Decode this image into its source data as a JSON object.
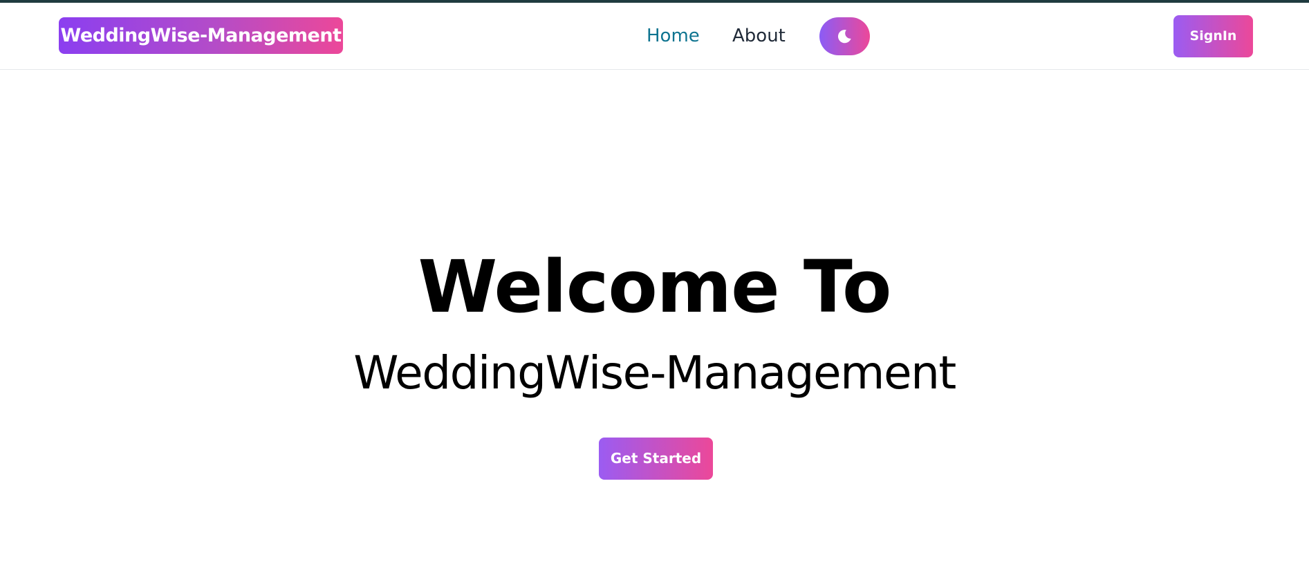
{
  "navbar": {
    "brand": "WeddingWise-Management",
    "links": [
      {
        "label": "Home",
        "active": true,
        "color": "#0e7490"
      },
      {
        "label": "About",
        "active": false,
        "color": "#1f2937"
      }
    ],
    "theme_toggle_icon": "moon-icon",
    "signin_label": "SignIn"
  },
  "hero": {
    "title": "Welcome To",
    "subtitle": "WeddingWise-Management",
    "cta_label": "Get Started"
  },
  "colors": {
    "gradient_start": "#8b5cf6",
    "gradient_end": "#ec4899",
    "top_border": "#1f3b3f",
    "active_link": "#0e7490"
  }
}
